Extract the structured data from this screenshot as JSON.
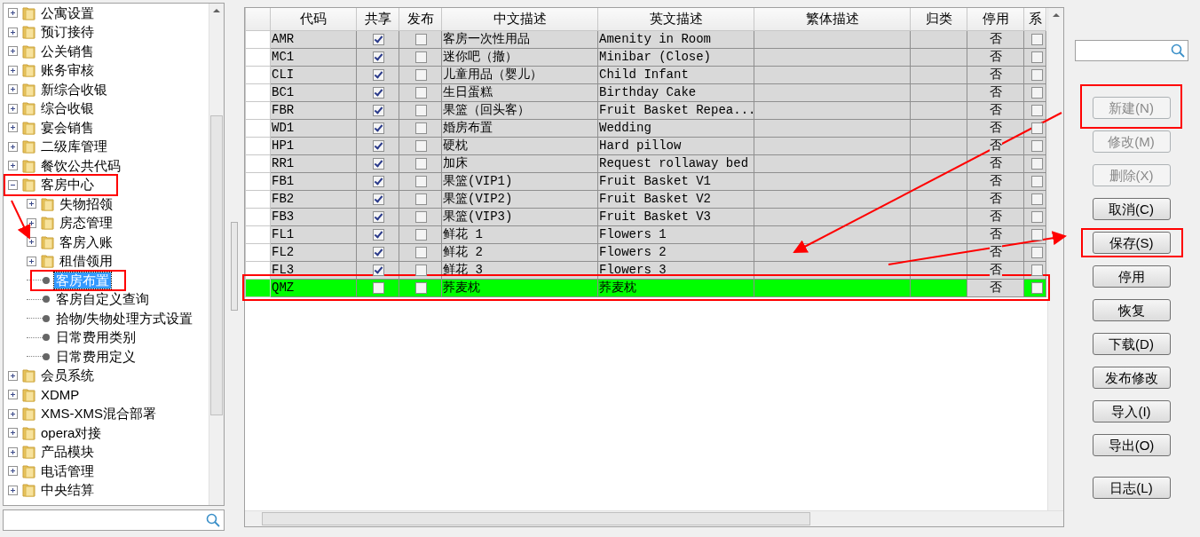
{
  "tree": {
    "items": [
      {
        "label": "公寓设置",
        "kind": "folder",
        "expanded": false,
        "selected": false
      },
      {
        "label": "预订接待",
        "kind": "folder",
        "expanded": false,
        "selected": false
      },
      {
        "label": "公关销售",
        "kind": "folder",
        "expanded": false,
        "selected": false
      },
      {
        "label": "账务审核",
        "kind": "folder",
        "expanded": false,
        "selected": false
      },
      {
        "label": "新综合收银",
        "kind": "folder",
        "expanded": false,
        "selected": false
      },
      {
        "label": "综合收银",
        "kind": "folder",
        "expanded": false,
        "selected": false
      },
      {
        "label": "宴会销售",
        "kind": "folder",
        "expanded": false,
        "selected": false
      },
      {
        "label": "二级库管理",
        "kind": "folder",
        "expanded": false,
        "selected": false
      },
      {
        "label": "餐饮公共代码",
        "kind": "folder",
        "expanded": false,
        "selected": false
      },
      {
        "label": "客房中心",
        "kind": "folder",
        "expanded": true,
        "selected": false,
        "children": [
          {
            "label": "失物招领",
            "kind": "folder",
            "expanded": false,
            "selected": false
          },
          {
            "label": "房态管理",
            "kind": "folder",
            "expanded": false,
            "selected": false
          },
          {
            "label": "客房入账",
            "kind": "folder",
            "expanded": false,
            "selected": false
          },
          {
            "label": "租借领用",
            "kind": "folder",
            "expanded": false,
            "selected": false
          },
          {
            "label": "客房布置",
            "kind": "leaf",
            "selected": true
          },
          {
            "label": "客房自定义查询",
            "kind": "leaf",
            "selected": false
          },
          {
            "label": "拾物/失物处理方式设置",
            "kind": "leaf",
            "selected": false
          },
          {
            "label": "日常费用类别",
            "kind": "leaf",
            "selected": false
          },
          {
            "label": "日常费用定义",
            "kind": "leaf",
            "selected": false
          }
        ]
      },
      {
        "label": "会员系统",
        "kind": "folder",
        "expanded": false,
        "selected": false
      },
      {
        "label": "XDMP",
        "kind": "folder",
        "expanded": false,
        "selected": false
      },
      {
        "label": "XMS-XMS混合部署",
        "kind": "folder",
        "expanded": false,
        "selected": false
      },
      {
        "label": "opera对接",
        "kind": "folder",
        "expanded": false,
        "selected": false
      },
      {
        "label": "产品模块",
        "kind": "folder",
        "expanded": false,
        "selected": false
      },
      {
        "label": "电话管理",
        "kind": "folder",
        "expanded": false,
        "selected": false
      },
      {
        "label": "中央结算",
        "kind": "folder",
        "expanded": false,
        "selected": false
      }
    ]
  },
  "table": {
    "columns": [
      "代码",
      "共享",
      "发布",
      "中文描述",
      "英文描述",
      "繁体描述",
      "归类",
      "停用",
      "系"
    ],
    "rows": [
      {
        "code": "AMR",
        "shared": true,
        "published": false,
        "cn": "客房一次性用品",
        "en": "Amenity in Room",
        "disabled": "否",
        "column_10_checked": false,
        "selected": false
      },
      {
        "code": "MC1",
        "shared": true,
        "published": false,
        "cn": "迷你吧（撤）",
        "en": "Minibar (Close)",
        "disabled": "否",
        "column_10_checked": false,
        "selected": false
      },
      {
        "code": "CLI",
        "shared": true,
        "published": false,
        "cn": "儿童用品（婴儿）",
        "en": "Child Infant",
        "disabled": "否",
        "column_10_checked": false,
        "selected": false
      },
      {
        "code": "BC1",
        "shared": true,
        "published": false,
        "cn": "生日蛋糕",
        "en": "Birthday Cake",
        "disabled": "否",
        "column_10_checked": false,
        "selected": false
      },
      {
        "code": "FBR",
        "shared": true,
        "published": false,
        "cn": "果篮（回头客）",
        "en": "Fruit Basket Repea...",
        "disabled": "否",
        "column_10_checked": false,
        "selected": false
      },
      {
        "code": "WD1",
        "shared": true,
        "published": false,
        "cn": "婚房布置",
        "en": "Wedding",
        "disabled": "否",
        "column_10_checked": false,
        "selected": false
      },
      {
        "code": "HP1",
        "shared": true,
        "published": false,
        "cn": "硬枕",
        "en": "Hard pillow",
        "disabled": "否",
        "column_10_checked": false,
        "selected": false
      },
      {
        "code": "RR1",
        "shared": true,
        "published": false,
        "cn": "加床",
        "en": "Request rollaway bed",
        "disabled": "否",
        "column_10_checked": false,
        "selected": false
      },
      {
        "code": "FB1",
        "shared": true,
        "published": false,
        "cn": "果篮(VIP1)",
        "en": "Fruit Basket V1",
        "disabled": "否",
        "column_10_checked": false,
        "selected": false
      },
      {
        "code": "FB2",
        "shared": true,
        "published": false,
        "cn": "果篮(VIP2)",
        "en": "Fruit Basket V2",
        "disabled": "否",
        "column_10_checked": false,
        "selected": false
      },
      {
        "code": "FB3",
        "shared": true,
        "published": false,
        "cn": "果篮(VIP3)",
        "en": "Fruit Basket V3",
        "disabled": "否",
        "column_10_checked": false,
        "selected": false
      },
      {
        "code": "FL1",
        "shared": true,
        "published": false,
        "cn": "鲜花 1",
        "en": "Flowers 1",
        "disabled": "否",
        "column_10_checked": false,
        "selected": false
      },
      {
        "code": "FL2",
        "shared": true,
        "published": false,
        "cn": "鲜花 2",
        "en": "Flowers 2",
        "disabled": "否",
        "column_10_checked": false,
        "selected": false
      },
      {
        "code": "FL3",
        "shared": true,
        "published": false,
        "cn": "鲜花 3",
        "en": "Flowers 3",
        "disabled": "否",
        "column_10_checked": false,
        "selected": false
      },
      {
        "code": "QMZ",
        "shared": false,
        "published": false,
        "cn": "荞麦枕",
        "en": "荞麦枕",
        "disabled": "否",
        "column_10_checked": false,
        "selected": true
      }
    ]
  },
  "buttons": [
    {
      "label": "新建(N)",
      "disabled": true
    },
    {
      "label": "修改(M)",
      "disabled": true
    },
    {
      "label": "删除(X)",
      "disabled": true
    },
    {
      "label": "取消(C)",
      "disabled": false
    },
    {
      "label": "保存(S)",
      "disabled": false
    },
    {
      "label": "停用",
      "disabled": false
    },
    {
      "label": "恢复",
      "disabled": false
    },
    {
      "label": "下载(D)",
      "disabled": false
    },
    {
      "label": "发布修改",
      "disabled": false
    },
    {
      "label": "导入(I)",
      "disabled": false
    },
    {
      "label": "导出(O)",
      "disabled": false
    },
    {
      "label": "日志(L)",
      "disabled": false
    }
  ]
}
